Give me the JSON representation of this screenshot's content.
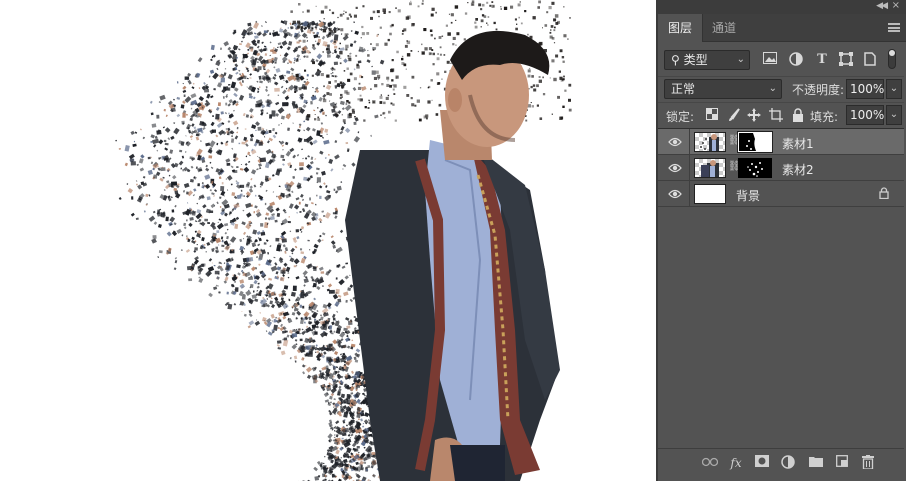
{
  "panel": {
    "tabs": [
      {
        "label": "图层",
        "active": true
      },
      {
        "label": "通道",
        "active": false
      }
    ],
    "filter": {
      "selected": "类型"
    },
    "blend_mode": {
      "selected": "正常"
    },
    "opacity": {
      "label": "不透明度:",
      "value": "100%"
    },
    "lock": {
      "label": "锁定:"
    },
    "fill": {
      "label": "填充:",
      "value": "100%"
    },
    "layers": [
      {
        "name": "素材1",
        "selected": true,
        "visible": true,
        "has_mask": true
      },
      {
        "name": "素材2",
        "selected": false,
        "visible": true,
        "has_mask": true
      },
      {
        "name": "背景",
        "selected": false,
        "visible": true,
        "locked": true
      }
    ],
    "bottom_icons": [
      "link-layers-icon",
      "fx-icon",
      "add-mask-icon",
      "adjustment-layer-icon",
      "group-folder-icon",
      "new-layer-icon",
      "trash-icon"
    ]
  },
  "colors": {
    "panel_bg": "#535353",
    "selected_layer": "#6a6a6a",
    "canvas_bg": "#ffffff"
  }
}
